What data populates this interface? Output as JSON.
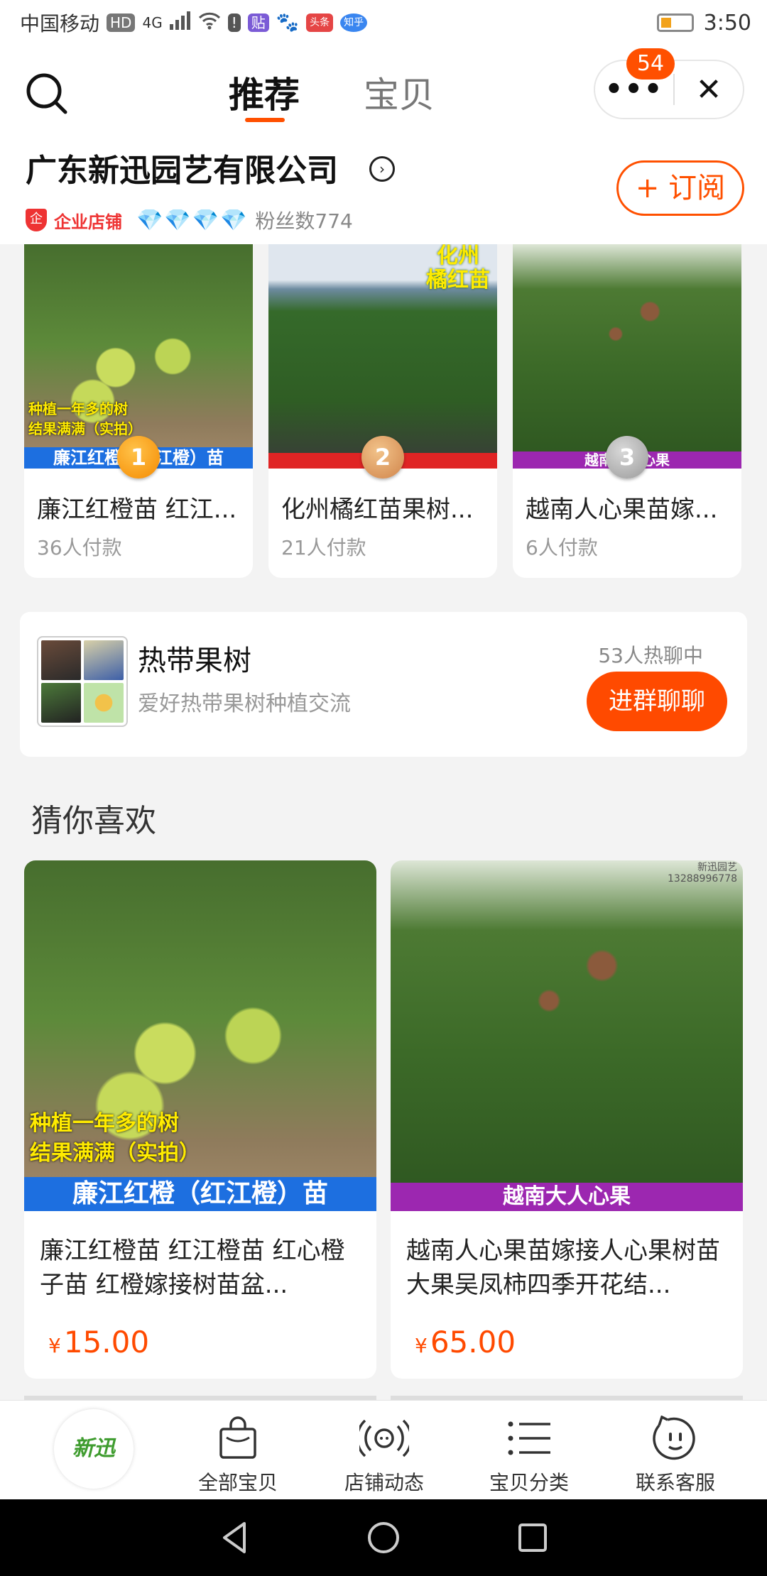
{
  "status_bar": {
    "carrier": "中国移动",
    "hd": "HD",
    "signal": "4G",
    "notif_icons": [
      "贴",
      "头条",
      "知乎"
    ],
    "time": "3:50"
  },
  "header": {
    "tabs": [
      {
        "label": "推荐",
        "active": true
      },
      {
        "label": "宝贝",
        "active": false
      }
    ],
    "badge_count": "54",
    "shop_name": "广东新迅园艺有限公司",
    "shop_type": "企业店铺",
    "diamonds": "💎💎💎💎",
    "fans": "粉丝数774",
    "follow_label": "+ 订阅"
  },
  "ranking": [
    {
      "rank": "1",
      "title": "廉江红橙苗 红江...",
      "sold": "36人付款",
      "image_note": "种植一年多的树\n结果满满（实拍）",
      "image_banner": "廉江红橙（红江橙）苗"
    },
    {
      "rank": "2",
      "title": "化州橘红苗果树...",
      "sold": "21人付款",
      "image_note": "化州\n橘红苗"
    },
    {
      "rank": "3",
      "title": "越南人心果苗嫁...",
      "sold": "6人付款",
      "image_banner": "越南大人心果"
    }
  ],
  "group": {
    "name": "热带果树",
    "desc": "爱好热带果树种植交流",
    "count": "53人热聊中",
    "join_label": "进群聊聊"
  },
  "guess": {
    "title": "猜你喜欢",
    "products": [
      {
        "title": "廉江红橙苗 红江橙苗 红心橙子苗 红橙嫁接树苗盆...",
        "price": "15.00",
        "currency": "¥",
        "image_note": "种植一年多的树\n结果满满（实拍）",
        "image_banner": "廉江红橙（红江橙）苗"
      },
      {
        "title": "越南人心果苗嫁接人心果树苗大果吴凤柿四季开花结...",
        "price": "65.00",
        "currency": "¥",
        "image_banner": "越南大人心果",
        "watermark": "新迅园艺\n13288996778"
      }
    ]
  },
  "bottom_nav": {
    "logo_text": "新迅",
    "items": [
      {
        "label": "全部宝贝",
        "icon": "bag-icon"
      },
      {
        "label": "店铺动态",
        "icon": "broadcast-icon"
      },
      {
        "label": "宝贝分类",
        "icon": "list-icon"
      },
      {
        "label": "联系客服",
        "icon": "service-icon"
      }
    ]
  },
  "colors": {
    "accent": "#ff5000",
    "price": "#ff4a00"
  }
}
